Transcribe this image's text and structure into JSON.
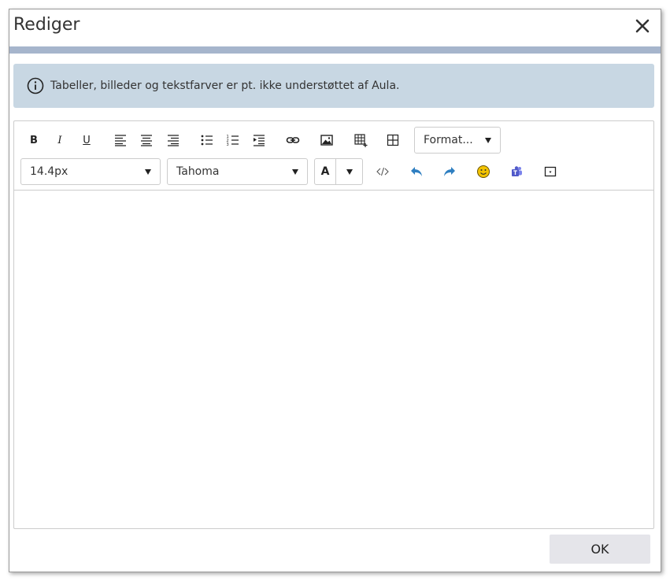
{
  "dialog": {
    "title": "Rediger",
    "close_icon": "close-icon"
  },
  "info": {
    "icon": "info-icon",
    "text": "Tabeller, billeder og tekstfarver er pt. ikke understøttet af Aula."
  },
  "toolbar": {
    "bold_label": "B",
    "italic_label": "I",
    "underline_label": "U",
    "format_label": "Format...",
    "font_size": "14.4px",
    "font_family": "Tahoma",
    "text_color_label": "A",
    "icons": {
      "align_left": "align-left-icon",
      "align_center": "align-center-icon",
      "align_right": "align-right-icon",
      "bullet_list": "bullet-list-icon",
      "numbered_list": "numbered-list-icon",
      "indent": "indent-icon",
      "link": "link-icon",
      "image": "image-icon",
      "insert_table": "insert-table-icon",
      "table": "table-icon",
      "source_code": "source-code-icon",
      "undo": "undo-icon",
      "redo": "redo-icon",
      "emoji": "emoji-icon",
      "teams": "teams-icon",
      "media": "media-icon"
    }
  },
  "footer": {
    "ok_label": "OK"
  },
  "colors": {
    "title_stripe": "#a6b5cc",
    "info_background": "#c8d7e3",
    "undo_redo": "#2f7fc1",
    "emoji": "#f2c300",
    "teams": "#5059c9",
    "ok_background": "#e5e5ea"
  }
}
